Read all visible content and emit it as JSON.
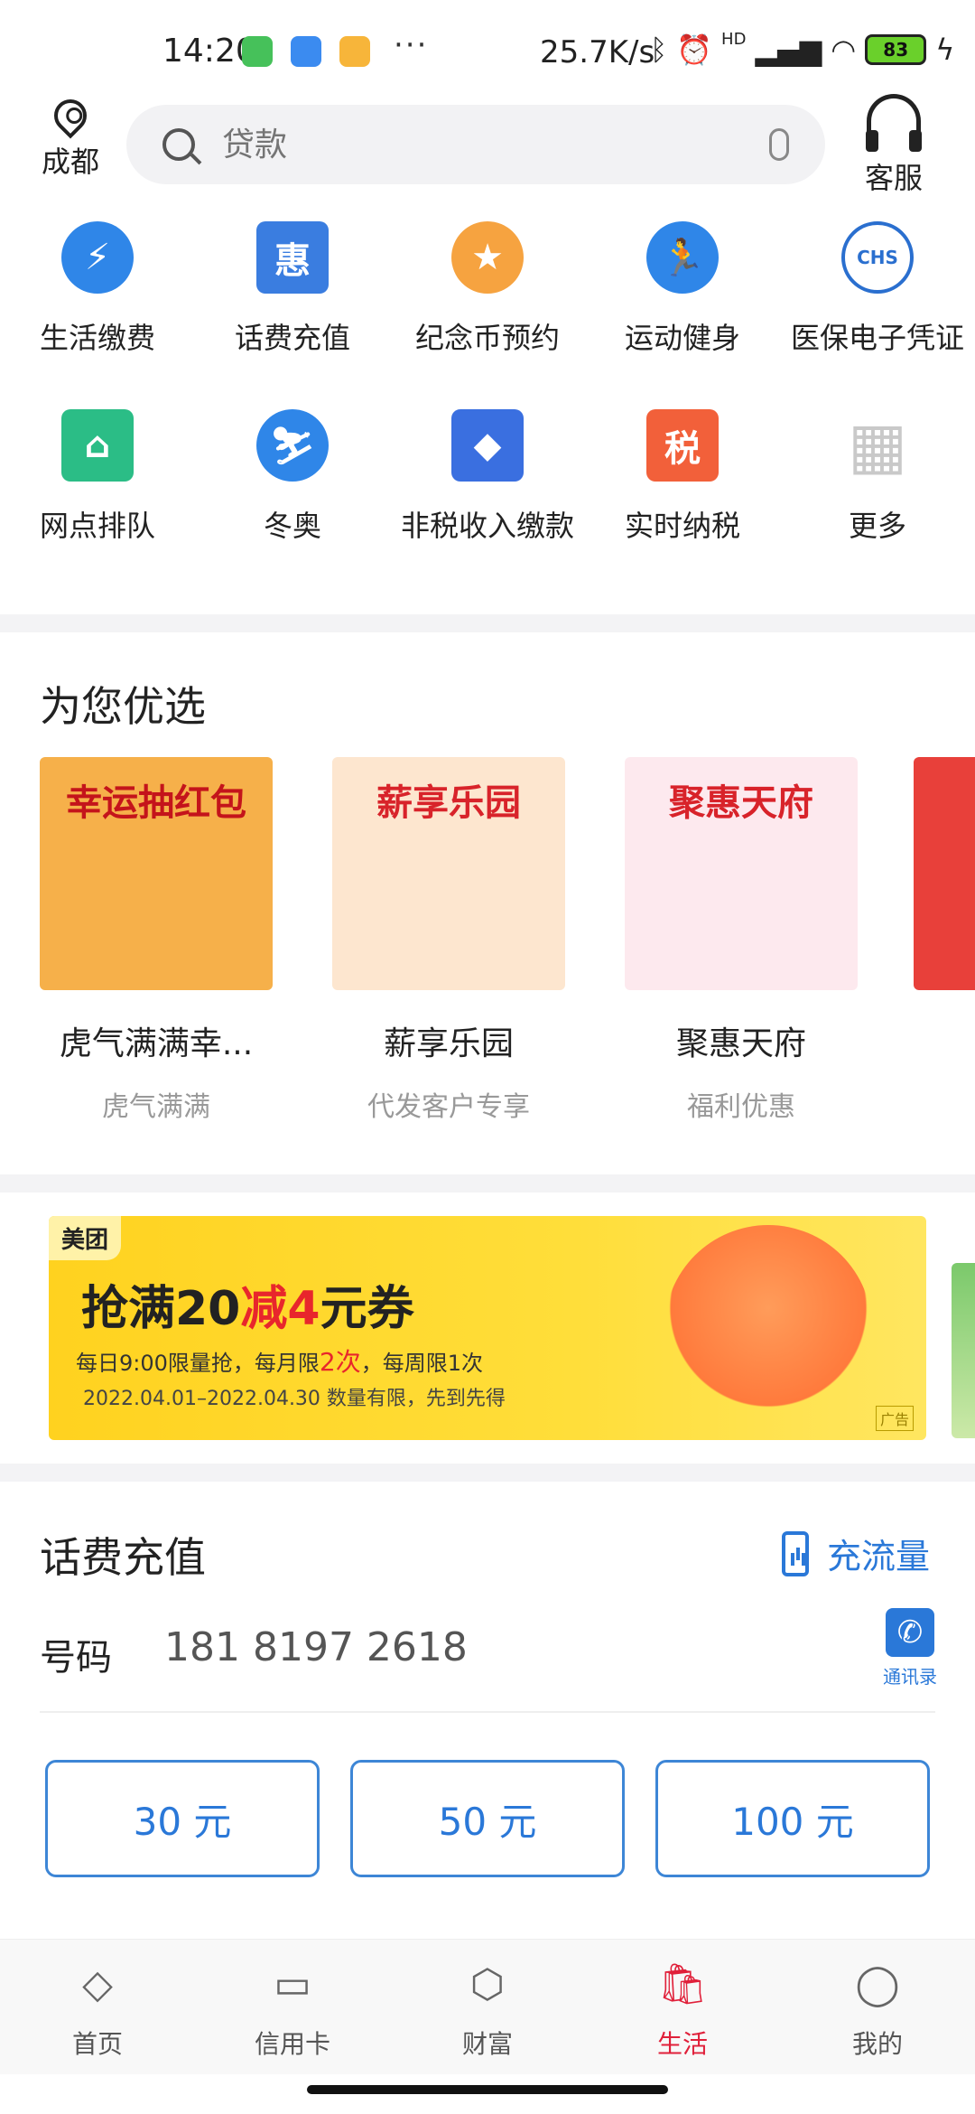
{
  "status_bar": {
    "time": "14:20",
    "dots": "···",
    "net_speed": "25.7K/s",
    "hd_label": "HD",
    "battery": "83"
  },
  "header": {
    "location": "成都",
    "search_placeholder": "贷款",
    "service_label": "客服"
  },
  "quick_grid": [
    {
      "label": "生活缴费",
      "icon": "lightning-icon",
      "color": "#2f86e8",
      "glyph": "⚡"
    },
    {
      "label": "话费充值",
      "icon": "hui-phone-icon",
      "color": "#3a7de0",
      "glyph": "惠"
    },
    {
      "label": "纪念币预约",
      "icon": "star-coin-icon",
      "color": "#f6a340",
      "glyph": "★"
    },
    {
      "label": "运动健身",
      "icon": "running-icon",
      "color": "#2f86e8",
      "glyph": "🏃"
    },
    {
      "label": "医保电子凭证",
      "icon": "chs-icon",
      "color": "#2a6fcf",
      "glyph": "CHS"
    },
    {
      "label": "网点排队",
      "icon": "branch-shop-icon",
      "color": "#2bbd86",
      "glyph": "⌂"
    },
    {
      "label": "冬奥",
      "icon": "skiing-icon",
      "color": "#2f86e8",
      "glyph": "⛷"
    },
    {
      "label": "非税收入缴款",
      "icon": "layered-card-icon",
      "color": "#3a6fe0",
      "glyph": "◆"
    },
    {
      "label": "实时纳税",
      "icon": "tax-icon",
      "color": "#f2603a",
      "glyph": "税"
    },
    {
      "label": "更多",
      "icon": "more-grid-icon",
      "color": "#c9c9c9",
      "glyph": "▦"
    }
  ],
  "picks": {
    "title": "为您优选",
    "items": [
      {
        "title": "虎气满满幸...",
        "sub": "虎气满满",
        "img_text": "幸运抽红包",
        "bg": "#f6b04a",
        "fg": "#c4141b"
      },
      {
        "title": "薪享乐园",
        "sub": "代发客户专享",
        "img_text": "薪享乐园",
        "bg": "#fde6cf",
        "fg": "#d8232a"
      },
      {
        "title": "聚惠天府",
        "sub": "福利优惠",
        "img_text": "聚惠天府",
        "bg": "#fde9ee",
        "fg": "#d8232a"
      }
    ]
  },
  "banner": {
    "brand": "美团",
    "headline_a": "抢满20",
    "headline_b": "减4",
    "headline_c": "元券",
    "line1_a": "每日9:00限量抢，每月限",
    "line1_b": "2次",
    "line1_c": "，每周限1次",
    "line2": "2022.04.01–2022.04.30 数量有限，先到先得",
    "ad": "广告"
  },
  "recharge": {
    "title": "话费充值",
    "flow_label": "充流量",
    "number_label": "号码",
    "number": "181 8197 2618",
    "contacts_label": "通讯录",
    "amounts": [
      "30 元",
      "50 元",
      "100 元"
    ]
  },
  "bottom_nav": [
    {
      "label": "首页",
      "icon": "diamond-icon",
      "glyph": "◇",
      "active": false
    },
    {
      "label": "信用卡",
      "icon": "credit-card-icon",
      "glyph": "▭",
      "active": false
    },
    {
      "label": "财富",
      "icon": "wealth-chart-icon",
      "glyph": "⬡",
      "active": false
    },
    {
      "label": "生活",
      "icon": "shopping-bag-icon",
      "glyph": "🛍",
      "active": true
    },
    {
      "label": "我的",
      "icon": "profile-icon",
      "glyph": "◯",
      "active": false
    }
  ],
  "colors": {
    "accent_blue": "#2a78d8",
    "active_red": "#e0203a",
    "banner_yellow": "#ffd21f"
  }
}
